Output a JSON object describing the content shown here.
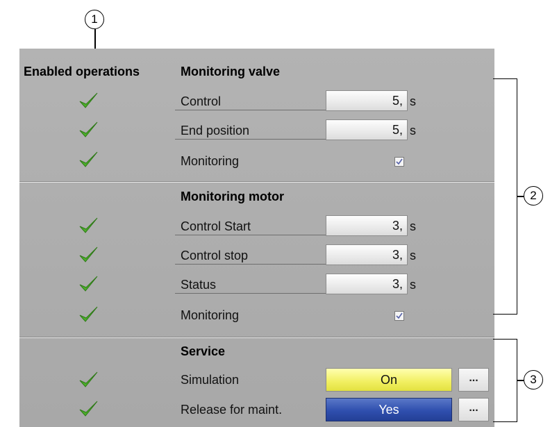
{
  "callouts": {
    "c1": "1",
    "c2": "2",
    "c3": "3"
  },
  "headers": {
    "enabled_operations": "Enabled operations",
    "monitoring_valve": "Monitoring valve",
    "monitoring_motor": "Monitoring motor",
    "service": "Service"
  },
  "valve": {
    "control": {
      "label": "Control",
      "value": "5,",
      "unit": "s"
    },
    "end_position": {
      "label": "End position",
      "value": "5,",
      "unit": "s"
    },
    "monitoring": {
      "label": "Monitoring",
      "checked": true
    }
  },
  "motor": {
    "control_start": {
      "label": "Control Start",
      "value": "3,",
      "unit": "s"
    },
    "control_stop": {
      "label": "Control stop",
      "value": "3,",
      "unit": "s"
    },
    "status": {
      "label": "Status",
      "value": "3,",
      "unit": "s"
    },
    "monitoring": {
      "label": "Monitoring",
      "checked": true
    }
  },
  "service": {
    "simulation": {
      "label": "Simulation",
      "value": "On",
      "dots": "..."
    },
    "release": {
      "label": "Release for maint.",
      "value": "Yes",
      "dots": "..."
    }
  },
  "colors": {
    "panel": "#acacac",
    "check_green": "#4caf2a",
    "on_yellow": "#f1ef60",
    "yes_blue": "#2f4fae"
  },
  "icons": {
    "enabled": "green-checkmark-icon",
    "checkbox_mark": "checkmark-icon"
  }
}
